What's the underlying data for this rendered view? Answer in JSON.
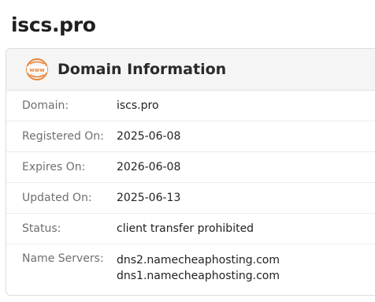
{
  "page": {
    "title": "iscs.pro"
  },
  "card": {
    "title": "Domain Information",
    "icon": "www-globe-icon",
    "accent_color": "#e8853b"
  },
  "fields": {
    "domain": {
      "label": "Domain:",
      "value": "iscs.pro"
    },
    "registered": {
      "label": "Registered On:",
      "value": "2025-06-08"
    },
    "expires": {
      "label": "Expires On:",
      "value": "2026-06-08"
    },
    "updated": {
      "label": "Updated On:",
      "value": "2025-06-13"
    },
    "status": {
      "label": "Status:",
      "value": "client transfer prohibited"
    },
    "name_servers": {
      "label": "Name Servers:",
      "values": [
        "dns2.namecheaphosting.com",
        "dns1.namecheaphosting.com"
      ]
    }
  }
}
